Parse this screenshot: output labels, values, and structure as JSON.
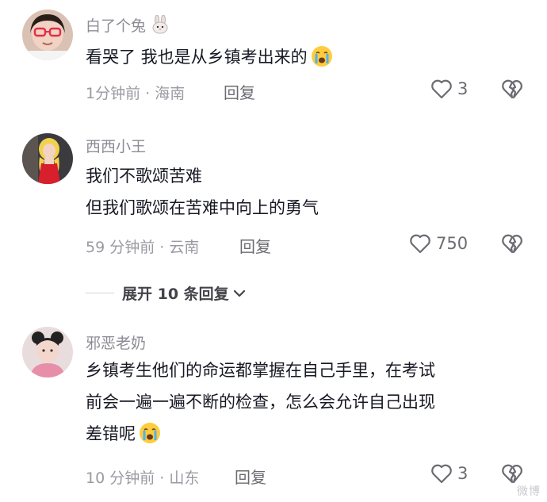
{
  "comments": [
    {
      "username": "白了个兔",
      "lines": [
        "看哭了 我也是从乡镇考出来的"
      ],
      "time": "1分钟前",
      "location": "海南",
      "reply_label": "回复",
      "likes": "3"
    },
    {
      "username": "西西小王",
      "lines": [
        "我们不歌颂苦难",
        "但我们歌颂在苦难中向上的勇气"
      ],
      "time": "59 分钟前",
      "location": "云南",
      "reply_label": "回复",
      "likes": "750"
    },
    {
      "username": "邪恶老奶",
      "lines": [
        "乡镇考生他们的命运都掌握在自己手里，在考试",
        "前会一遍一遍不断的检查，怎么会允许自己出现",
        "差错呢"
      ],
      "time": "10 分钟前",
      "location": "山东",
      "reply_label": "回复",
      "likes": "3"
    }
  ],
  "expand_replies": "展开 10 条回复",
  "watermark": "微博"
}
